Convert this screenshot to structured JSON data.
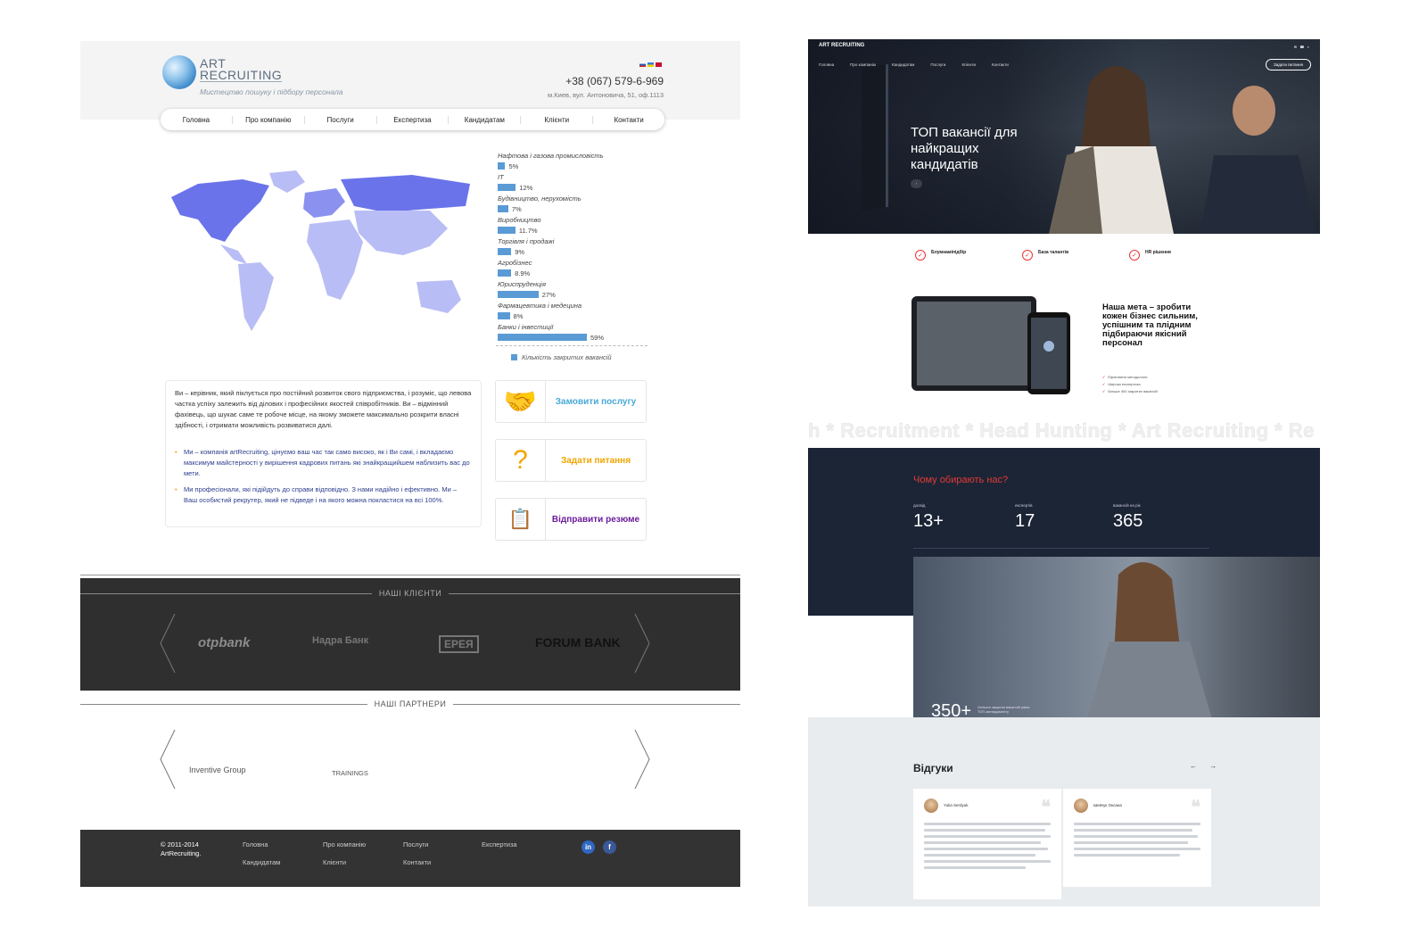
{
  "old_site": {
    "logo": {
      "line1": "ART",
      "line2": "RECRUITING",
      "tagline": "Мистецтво пошуку і підбору персонала"
    },
    "phone": "+38 (067) 579-6-969",
    "address": "м.Киев, вул. Антоновича, 51, оф.1113",
    "nav": [
      "Головна",
      "Про компанію",
      "Послуги",
      "Експертиза",
      "Кандидатам",
      "Клієнти",
      "Контакти"
    ],
    "chart_data": {
      "type": "bar",
      "categories": [
        "Нафтова і газова промисловість",
        "IT",
        "Будівництво, нерухомість",
        "Виробництво",
        "Торгівля і продажі",
        "Агробізнес",
        "Юриспруденція",
        "Фармацевтика і медецина",
        "Банки і інвестиції"
      ],
      "values": [
        5,
        12,
        7,
        11.7,
        9,
        8.9,
        27,
        8,
        59
      ],
      "labels": [
        "5%",
        "12%",
        "7%",
        "11.7%",
        "9%",
        "8.9%",
        "27%",
        "8%",
        "59%"
      ],
      "legend": "Кількість закритих вакансій",
      "color": "#5a9bd5"
    },
    "intro_text": "Ви – керівник, який піклується про постійний розвиток свого підприємства, і розуміє, що левова частка успіху залежить від ділових і професійних якостей співробітників. Ви – відмінний фахівець, що шукає саме те робоче місце, на якому зможете максимально розкрити власні здібності, і отримати можливість розвиватися далі.",
    "bullets": [
      "Ми – компанія artRecruiting, цінуємо ваш час так само високо, як і Ви самі, і вкладаємо максимум майстерності у вирішення кадрових питань які знайкращийшем наблизить вас до мети.",
      "Ми професіонали, які підійдуть до справи відповідно. З нами надійно і ефективно. Ми – Ваш особистий рекрутер, який не підведе і на якого можна покластися на всі 100%."
    ],
    "actions": [
      {
        "label": "Замовити послугу",
        "color": "#4aa9d6"
      },
      {
        "label": "Задати питання",
        "color": "#f0a500"
      },
      {
        "label": "Відправити резюме",
        "color": "#6a1b9a"
      }
    ],
    "clients_title": "НАШІ КЛІЄНТИ",
    "clients": [
      "otpbank",
      "Надра Банк",
      "ЕРЕЯ",
      "FORUM BANK"
    ],
    "partners_title": "НАШІ ПАРТНЕРИ",
    "partners": [
      "Inventive Group",
      "TRAININGS"
    ],
    "footer": {
      "copyright_1": "© 2011-2014",
      "copyright_2": "ArtRecruiting.",
      "links": [
        "Головна",
        "Про компанію",
        "Послуги",
        "Експертиза",
        "Кандидатам",
        "Клієнти",
        "Контакти"
      ]
    }
  },
  "new_site": {
    "logo": "ART RECRUITING",
    "hero_title": "ТОП вакансії для найкращих кандидатів",
    "hero_button": "Задати питання",
    "features": [
      {
        "title": "Блумнаміпідбір"
      },
      {
        "title": "База талантів"
      },
      {
        "title": "HR рішення"
      }
    ],
    "goal_title": "Наша мета – зробити кожен бізнес сильним, успішним та плідним підбираючи якісний персонал",
    "checks": [
      "Ефективна методологія",
      "Широка експертиза",
      "Більше 400 закритих вакансій"
    ],
    "ticker": "h * Recruitment * Head Hunting * Art Recruiting * Re",
    "why_title": "Чому обирають нас?",
    "stats": [
      {
        "label": "досвід",
        "value": "13+"
      },
      {
        "label": "експертів",
        "value": "17"
      },
      {
        "label": "вакансій на рік",
        "value": "365"
      }
    ],
    "big_stat": {
      "value": "350+",
      "text": "Успішно закрили вакансій рівня ТОП-менеджменту"
    },
    "reviews_title": "Відгуки",
    "review_arrows": "← →",
    "reviewers": [
      "Yulia Serdyuk",
      "Шевчук Оксана"
    ]
  }
}
